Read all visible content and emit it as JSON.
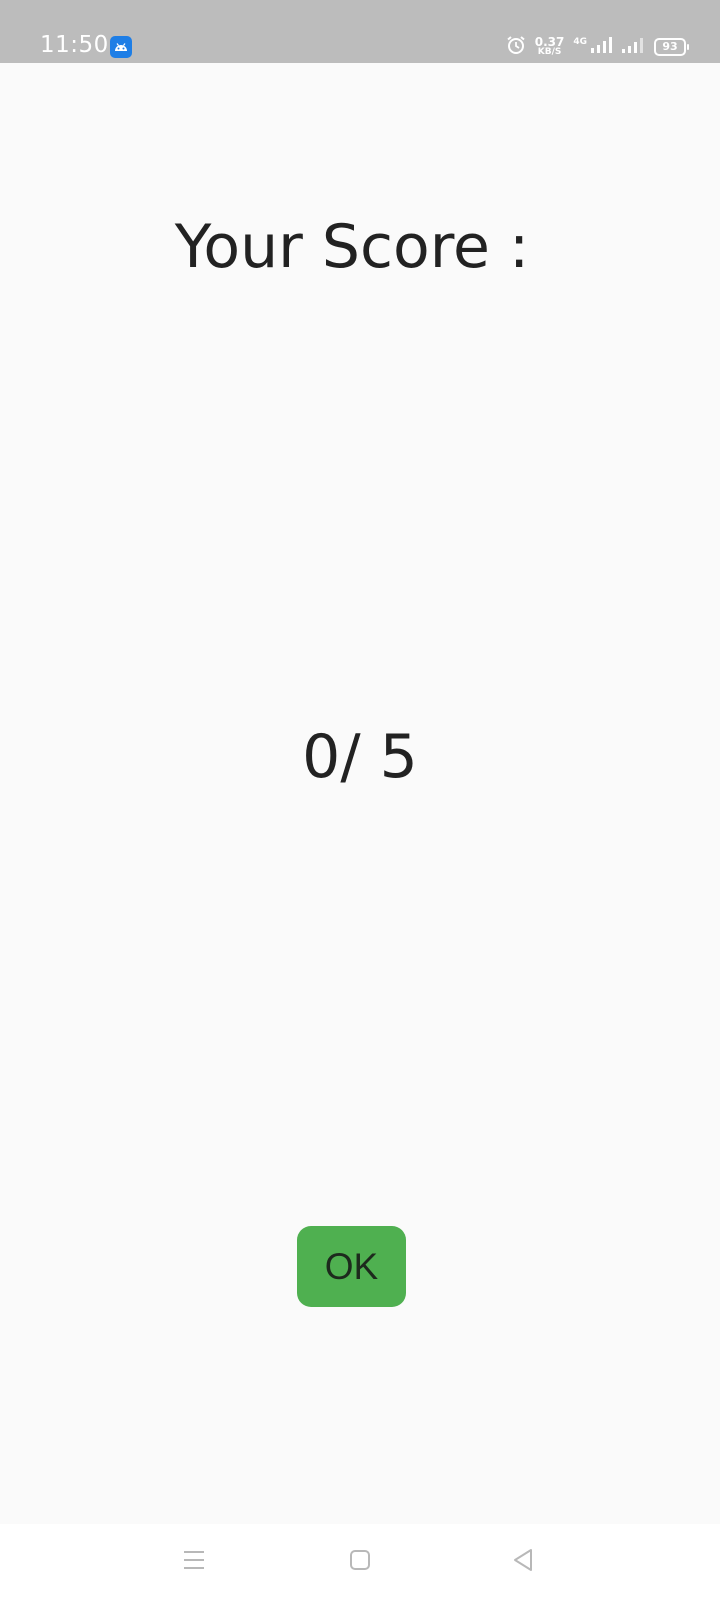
{
  "status_bar": {
    "time": "11:50",
    "net_speed_value": "0.37",
    "net_speed_unit": "KB/S",
    "network_type": "4G",
    "battery": "93",
    "icons": [
      "android-app-icon",
      "alarm-icon",
      "signal-icon",
      "signal-icon-2",
      "battery-icon"
    ]
  },
  "score_screen": {
    "title": "Your Score :",
    "score": "0/ 5",
    "ok_label": "OK"
  },
  "nav_bar": {
    "icons": [
      "menu-icon",
      "home-icon",
      "back-icon"
    ]
  },
  "colors": {
    "status_bar_bg": "#bcbcbc",
    "background": "#fafafa",
    "ok_button_bg": "#4fb050",
    "text": "#222222"
  }
}
